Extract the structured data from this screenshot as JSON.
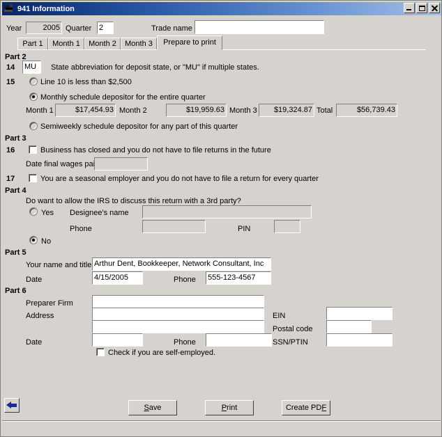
{
  "window": {
    "title": "941 Information",
    "icon": "app-icon",
    "controls": {
      "minimize": "minimize-icon",
      "maximize": "maximize-icon",
      "close": "close-icon"
    },
    "colors": {
      "titlebar_start": "#0a246a",
      "titlebar_end": "#a6c0e8",
      "face": "#d6d3ce",
      "field": "#ffffff",
      "readonly_field": "#d6d3ce",
      "accent_arrow": "#1a2a8a"
    }
  },
  "header": {
    "year_label": "Year",
    "year_value": "2005",
    "quarter_label": "Quarter",
    "quarter_value": "2",
    "trade_name_label": "Trade name",
    "trade_name_value": ""
  },
  "tabs": [
    {
      "label": "Part 1",
      "selected": false
    },
    {
      "label": "Month 1",
      "selected": false
    },
    {
      "label": "Month 2",
      "selected": false
    },
    {
      "label": "Month 3",
      "selected": false
    },
    {
      "label": "Prepare to print",
      "selected": true
    }
  ],
  "part2": {
    "heading": "Part 2",
    "line14_number": "14",
    "line14_value": "MU",
    "line14_text": "State abbreviation for deposit state, or \"MU\" if multiple states.",
    "line15_number": "15",
    "option_less_than": "Line 10 is less than $2,500",
    "option_monthly": "Monthly schedule depositor for the entire quarter",
    "option_semiweekly": "Semiweekly schedule depositor for any part of this quarter",
    "selected_option": "monthly",
    "month1_label": "Month 1",
    "month1_value": "$17,454.93",
    "month2_label": "Month 2",
    "month2_value": "$19,959.63",
    "month3_label": "Month 3",
    "month3_value": "$19,324.87",
    "total_label": "Total",
    "total_value": "$56,739.43"
  },
  "part3": {
    "heading": "Part 3",
    "line16_number": "16",
    "line16_text": "Business has closed and you do not have to file returns in the future",
    "line16_checked": false,
    "date_final_wages_label": "Date final wages paid",
    "date_final_wages_value": "",
    "line17_number": "17",
    "line17_text": "You are a seasonal employer and you do not have to file a return for every quarter",
    "line17_checked": false
  },
  "part4": {
    "heading": "Part 4",
    "question": "Do want to allow the IRS to discuss this return with a 3rd party?",
    "yes_label": "Yes",
    "no_label": "No",
    "selected": "no",
    "designee_label": "Designee's name",
    "designee_value": "",
    "phone_label": "Phone",
    "phone_value": "",
    "pin_label": "PIN",
    "pin_value": ""
  },
  "part5": {
    "heading": "Part 5",
    "name_title_label": "Your name and title",
    "name_title_value": "Arthur Dent, Bookkeeper, Network Consultant, Inc",
    "date_label": "Date",
    "date_value": "4/15/2005",
    "phone_label": "Phone",
    "phone_value": "555-123-4567"
  },
  "part6": {
    "heading": "Part 6",
    "preparer_firm_label": "Preparer Firm",
    "preparer_firm_value": "",
    "address_label": "Address",
    "address_line1_value": "",
    "address_line2_value": "",
    "date_label": "Date",
    "date_value": "",
    "phone_label": "Phone",
    "phone_value": "",
    "ein_label": "EIN",
    "ein_value": "",
    "postal_code_label": "Postal code",
    "postal_code_value": "",
    "ssn_ptin_label": "SSN/PTIN",
    "ssn_ptin_value": "",
    "self_employed_label": "Check if you are self-employed.",
    "self_employed_checked": false
  },
  "footer": {
    "back_icon": "back-arrow-icon",
    "save_pre": "",
    "save_acc": "S",
    "save_post": "ave",
    "print_pre": "",
    "print_acc": "P",
    "print_post": "rint",
    "pdf_pre": "Create PD",
    "pdf_acc": "F",
    "pdf_post": ""
  }
}
